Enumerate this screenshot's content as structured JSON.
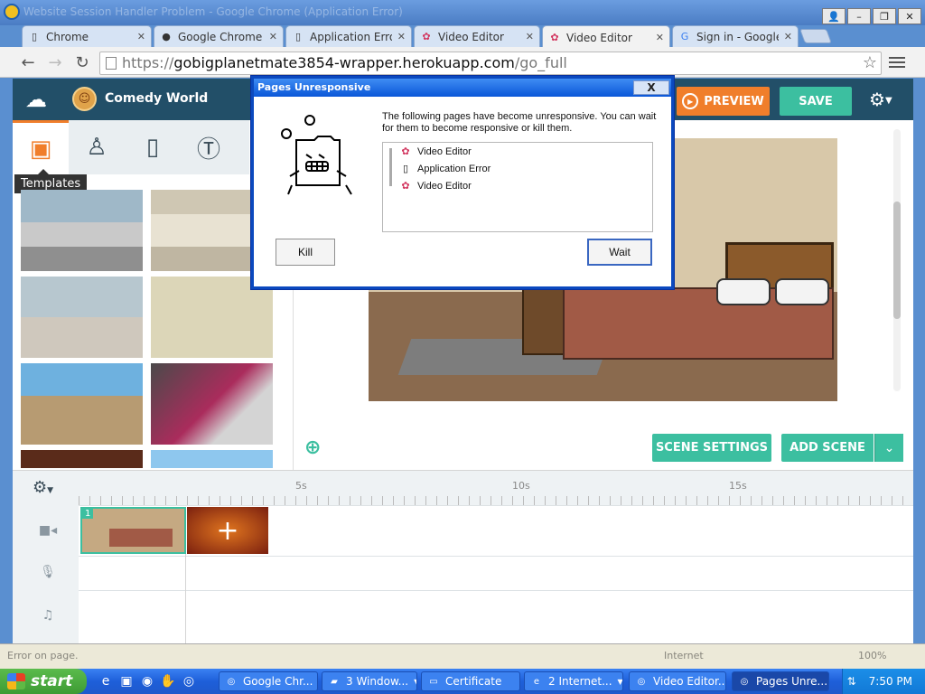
{
  "window": {
    "title": "Website Session Handler Problem - Google Chrome (Application Error)",
    "controls": [
      "👤",
      "–",
      "❐",
      "✕"
    ]
  },
  "tabs": [
    {
      "label": "Chrome",
      "icon": "page-icon",
      "active": false
    },
    {
      "label": "Google Chrome - D",
      "icon": "chrome-icon",
      "active": false
    },
    {
      "label": "Application Error",
      "icon": "page-icon",
      "active": false
    },
    {
      "label": "Video Editor",
      "icon": "puzzle-icon",
      "active": false
    },
    {
      "label": "Video Editor",
      "icon": "puzzle-icon",
      "active": true
    },
    {
      "label": "Sign in - Google A",
      "icon": "google-icon",
      "active": false
    }
  ],
  "toolbar": {
    "back": "←",
    "forward": "→",
    "reload": "↻",
    "url_scheme": "https://",
    "url_host": "gobigplanetmate3854-wrapper.herokuapp.com",
    "url_path": "/go_full",
    "star": "☆"
  },
  "app": {
    "project_name": "Comedy World",
    "avatar_glyph": "☺",
    "preview_label": "PREVIEW",
    "save_label": "SAVE",
    "tooltip": "Templates",
    "scene_settings_label": "SCENE SETTINGS",
    "add_scene_label": "ADD SCENE",
    "accent_orange": "#f07e2b",
    "accent_green": "#3cbfa0",
    "header_bg": "#224f68"
  },
  "timeline": {
    "ruler_labels": [
      "5s",
      "10s",
      "15s"
    ],
    "clip_number": "1",
    "add_glyph": "+",
    "track_icons": [
      "camera-icon",
      "microphone-icon",
      "music-icon"
    ]
  },
  "status_bar": {
    "left": "Error on page.",
    "zone": "Internet",
    "zoom": "100%"
  },
  "dialog": {
    "title": "Pages Unresponsive",
    "close_glyph": "X",
    "message": "The following pages have become unresponsive. You can wait for them to become responsive or kill them.",
    "items": [
      {
        "label": "Video Editor",
        "icon": "puzzle-icon"
      },
      {
        "label": "Application Error",
        "icon": "page-icon"
      },
      {
        "label": "Video Editor",
        "icon": "puzzle-icon"
      }
    ],
    "kill_label": "Kill",
    "wait_label": "Wait"
  },
  "taskbar": {
    "start_label": "start",
    "tasks": [
      {
        "label": "Google Chr...",
        "icon": "chrome-icon",
        "active": false
      },
      {
        "label": "3 Window...",
        "icon": "folder-icon",
        "active": false,
        "caret": "▼"
      },
      {
        "label": "Certificate",
        "icon": "certificate-icon",
        "active": false
      },
      {
        "label": "2 Internet...",
        "icon": "ie-icon",
        "active": false,
        "caret": "▼"
      },
      {
        "label": "Video Editor...",
        "icon": "chrome-icon",
        "active": false
      },
      {
        "label": "Pages Unre...",
        "icon": "chrome-icon",
        "active": true
      }
    ],
    "clock": "7:50 PM"
  }
}
